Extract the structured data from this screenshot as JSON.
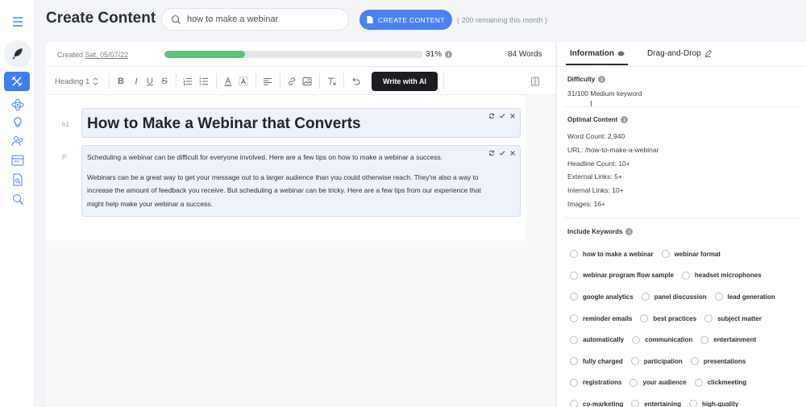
{
  "header": {
    "title": "Create Content",
    "search_value": "how to make a webinar",
    "create_button": "CREATE CONTENT",
    "remaining": "( 200 remaining this month )"
  },
  "meta": {
    "created_prefix": "Created",
    "created_date": "Sat, 05/07/22",
    "progress_percent": 31,
    "progress_label": "31%",
    "words": "84 Words"
  },
  "toolbar": {
    "heading_select": "Heading 1",
    "write_ai": "Write with AI"
  },
  "content": {
    "h1_label": "h1",
    "p_label": "P",
    "heading": "How to Make a Webinar that Converts",
    "paragraph1": "Scheduling a webinar can be difficult for everyone involved. Here are a few tips on how to make a webinar a success.",
    "paragraph2": "Webinars can be a great way to get your message out to a larger audience than you could otherwise reach. They're also a way to increase the amount of feedback you receive. But scheduling a webinar can be tricky. Here are a few tips from our experience that might help make your webinar a success."
  },
  "panel": {
    "tabs": [
      "Information",
      "Drag-and-Drop"
    ],
    "difficulty_title": "Difficulty",
    "difficulty_value": "31/100 Medium keyword",
    "optimal_title": "Optimal Content",
    "optimal": [
      "Word Count:  2,940",
      "URL:  /how-to-make-a-webinar",
      "Headline Count:  10+",
      "External Links:  5+",
      "Internal Links:  10+",
      "Images:  16+"
    ],
    "keywords_title": "Include Keywords",
    "keyword_rows": [
      [
        "how to make a webinar",
        "webinar format"
      ],
      [
        "webinar program flow sample",
        "headset microphones"
      ],
      [
        "google analytics",
        "panel discussion",
        "lead generation"
      ],
      [
        "reminder emails",
        "best practices",
        "subject matter"
      ],
      [
        "automatically",
        "communication",
        "entertainment"
      ],
      [
        "fully charged",
        "participation",
        "presentations"
      ],
      [
        "registrations",
        "your audience",
        "clickmeeting"
      ],
      [
        "co-marketing",
        "entertaining",
        "high-quality"
      ]
    ]
  },
  "colors": {
    "accent": "#4b82f1",
    "progress": "#5cc27a",
    "ai_button": "#1b1d22",
    "block_bg": "#eef2fb"
  }
}
